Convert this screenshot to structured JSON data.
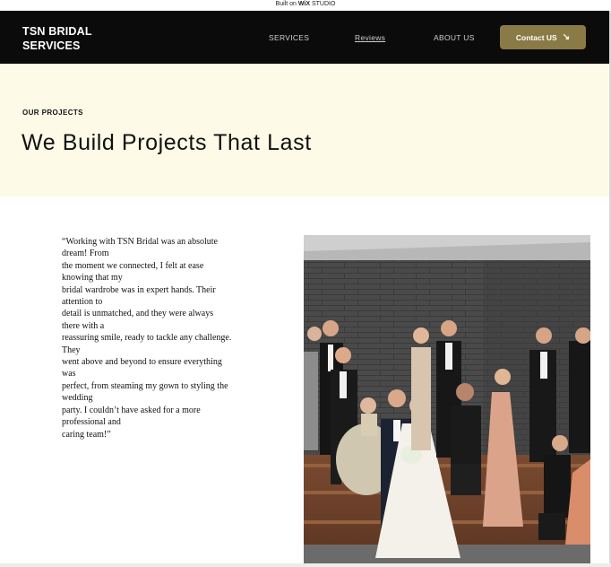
{
  "wix_banner": {
    "prefix": "Built on",
    "brand": "WiX",
    "suffix": "STUDIO"
  },
  "header": {
    "logo_line1": "TSN BRIDAL",
    "logo_line2": "SERVICES",
    "nav": [
      {
        "label": "SERVICES"
      },
      {
        "label": "Reviews"
      },
      {
        "label": "ABOUT US"
      }
    ],
    "contact_label": "Contact US",
    "contact_icon": "arrow-down-right-icon",
    "accent_color": "#8a7a45"
  },
  "hero": {
    "eyebrow": "OUR PROJECTS",
    "title": "We Build Projects That Last",
    "background": "#fdfbe7"
  },
  "testimonial": {
    "lines": [
      "“Working with TSN Bridal was an absolute",
      "dream! From",
      "the moment we connected, I felt at ease",
      "knowing that my",
      "bridal wardrobe was in expert hands. Their",
      "attention to",
      "detail is unmatched, and they were always",
      "there with a",
      "reassuring smile, ready to tackle any challenge.",
      "They",
      "went above and beyond to ensure everything",
      "was",
      "perfect, from steaming my gown to styling the",
      "wedding",
      "party. I couldn’t have asked for a more",
      "professional and",
      "caring team!”"
    ]
  },
  "photo": {
    "subject": "wedding-party-photo"
  }
}
